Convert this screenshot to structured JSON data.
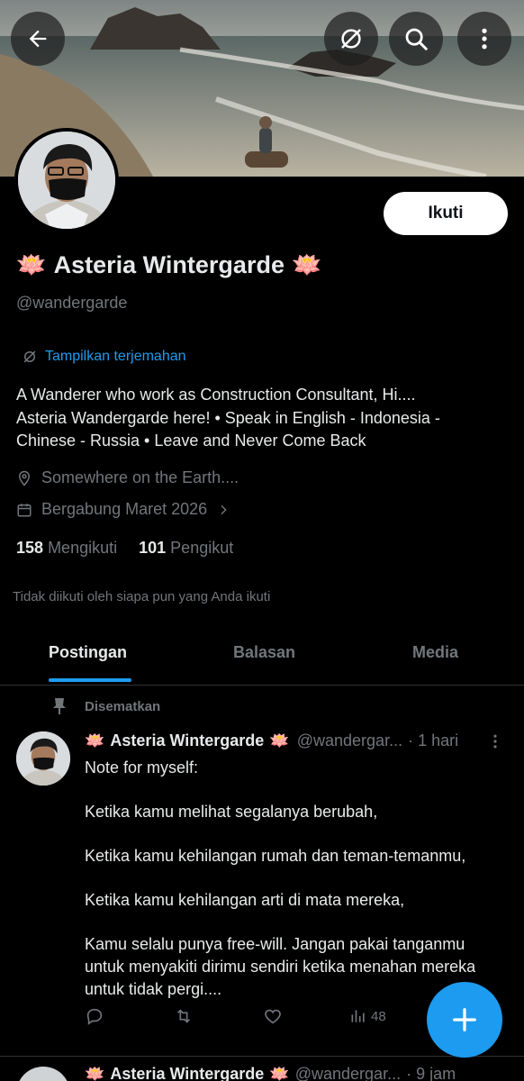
{
  "header": {
    "back_icon": "arrow-left-icon",
    "translate_icon": "translate-icon",
    "search_icon": "search-icon",
    "more_icon": "more-vertical-icon"
  },
  "profile": {
    "name": "Asteria Wintergarde",
    "name_emoji": "🪷",
    "handle": "@wandergarde",
    "follow_label": "Ikuti",
    "translate_label": "Tampilkan terjemahan",
    "bio_line1": "A Wanderer who work as Construction Consultant, Hi....",
    "bio_line2": "Asteria Wandergarde here! • Speak in English - Indonesia -",
    "bio_line3": "Chinese - Russia • Leave and Never Come Back",
    "location": "Somewhere on the Earth....",
    "joined": "Bergabung Maret 2026",
    "following_count": "158",
    "following_label": "Mengikuti",
    "followers_count": "101",
    "followers_label": "Pengikut",
    "not_followed_note": "Tidak diikuti oleh siapa pun yang Anda ikuti"
  },
  "tabs": [
    {
      "label": "Postingan",
      "active": true
    },
    {
      "label": "Balasan",
      "active": false
    },
    {
      "label": "Media",
      "active": false
    }
  ],
  "pinned_post": {
    "pinned_label": "Disematkan",
    "author": "Asteria Wintergarde",
    "handle": "@wandergar...",
    "time": "· 1 hari",
    "paragraphs": [
      "Note for myself:",
      "Ketika kamu melihat segalanya berubah,",
      "Ketika kamu kehilangan rumah dan teman-temanmu,",
      "Ketika kamu kehilangan arti di mata mereka,",
      "Kamu selalu punya free-will. Jangan pakai tanganmu untuk menyakiti dirimu sendiri ketika menahan mereka untuk tidak pergi...."
    ],
    "views": "48"
  },
  "next_post": {
    "author": "Asteria Wintergarde",
    "handle": "@wandergar...",
    "time": "· 9 jam"
  },
  "fab": {
    "icon": "plus-icon"
  },
  "colors": {
    "accent": "#1d9bf0",
    "muted": "#71767b",
    "text": "#e7e9ea",
    "background": "#000000"
  }
}
